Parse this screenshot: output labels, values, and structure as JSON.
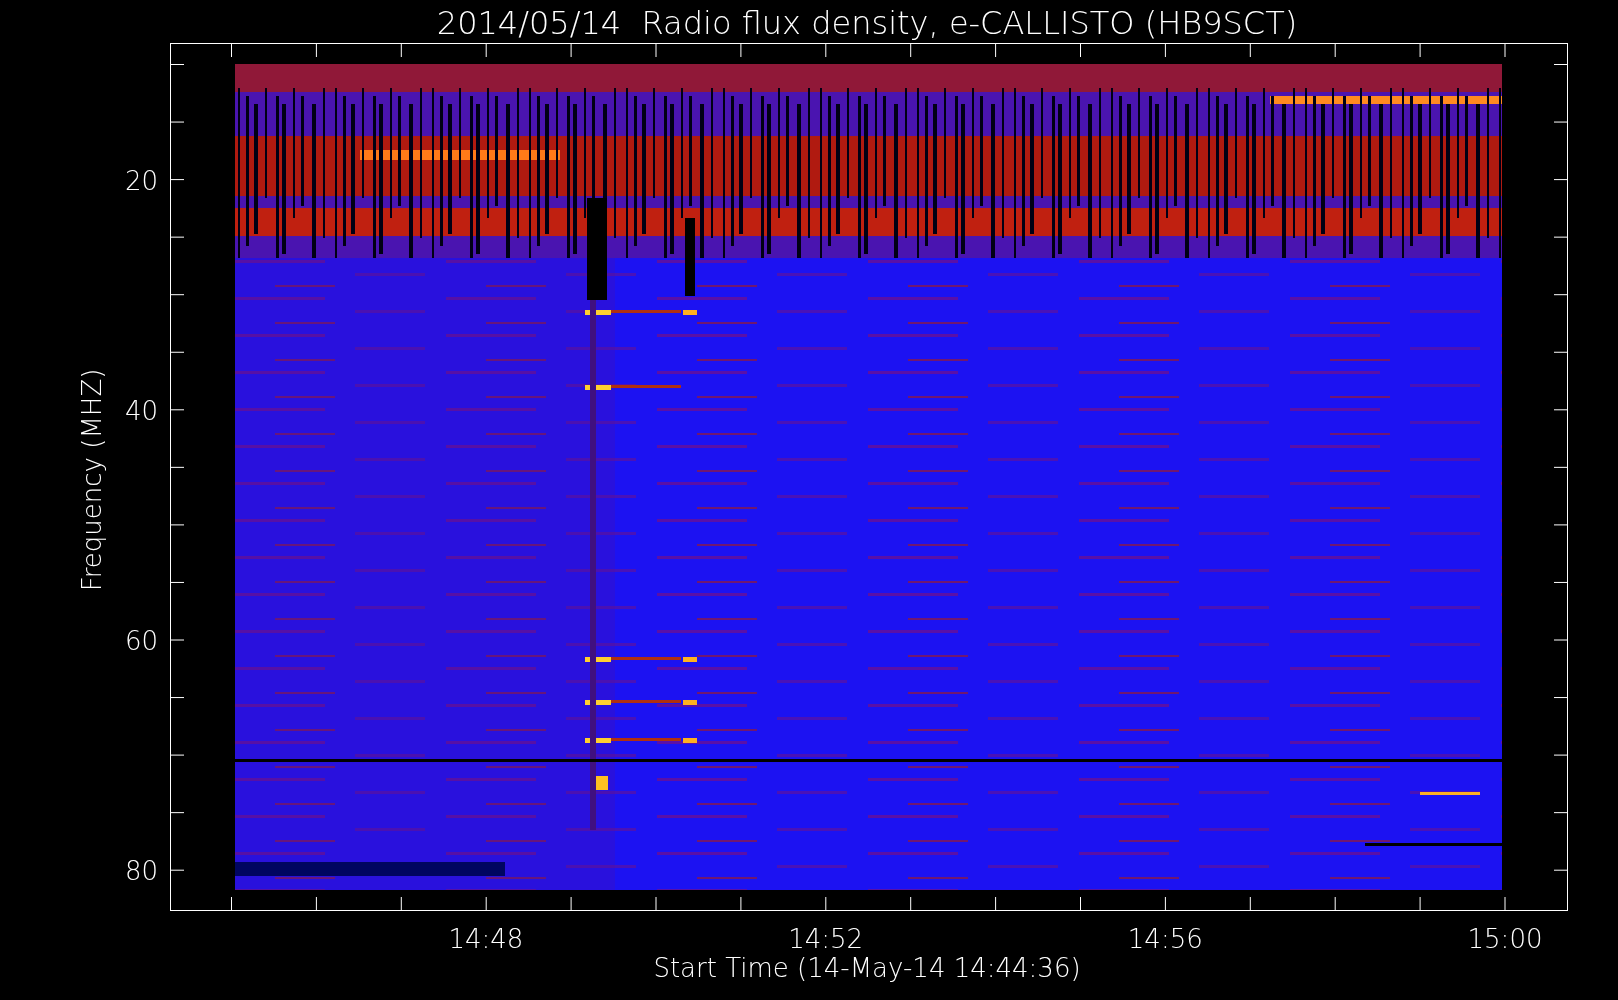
{
  "plot": {
    "title": "2014/05/14  Radio flux density, e-CALLISTO (HB9SCT)",
    "xlabel": "Start Time (14-May-14 14:44:36)",
    "ylabel": "Frequency (MHZ)",
    "xticks": [
      "14:48",
      "14:52",
      "14:56",
      "15:00"
    ],
    "yticks": [
      "20",
      "40",
      "60",
      "80"
    ]
  }
}
